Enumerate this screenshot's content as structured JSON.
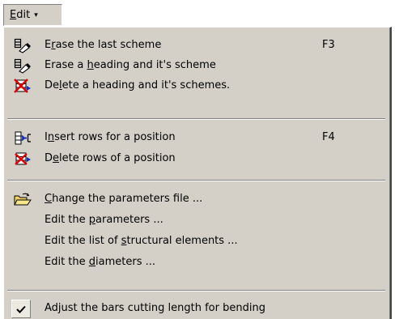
{
  "menu": {
    "title_underlined": "E",
    "title_rest": "dit",
    "arrow": "▾"
  },
  "items": [
    {
      "icon": "erase-scheme-icon",
      "before": "E",
      "u": "r",
      "after": "ase the last scheme",
      "shortcut": "F3"
    },
    {
      "icon": "erase-heading-icon",
      "before": "Erase a ",
      "u": "h",
      "after": "eading and it's scheme",
      "shortcut": ""
    },
    {
      "icon": "delete-heading-icon",
      "before": "De",
      "u": "l",
      "after": "ete a heading and it's schemes.",
      "shortcut": ""
    },
    {
      "icon": "insert-rows-icon",
      "before": "I",
      "u": "n",
      "after": "sert rows for a position",
      "shortcut": "F4"
    },
    {
      "icon": "delete-rows-icon",
      "before": "D",
      "u": "e",
      "after": "lete rows of a position",
      "shortcut": ""
    },
    {
      "icon": "open-folder-icon",
      "before": "",
      "u": "C",
      "after": "hange the parameters file ...",
      "shortcut": ""
    },
    {
      "icon": "",
      "before": "Edit the ",
      "u": "p",
      "after": "arameters ...",
      "shortcut": ""
    },
    {
      "icon": "",
      "before": "Edit the list of ",
      "u": "s",
      "after": "tructural elements ...",
      "shortcut": ""
    },
    {
      "icon": "",
      "before": "Edit the ",
      "u": "d",
      "after": "iameters ...",
      "shortcut": ""
    },
    {
      "icon": "check-icon",
      "before": "Adjust the bars cutting length for bending",
      "u": "",
      "after": "",
      "shortcut": ""
    }
  ],
  "colors": {
    "menu_bg": "#d4d0c8",
    "red_icon": "#e00000",
    "blue_icon": "#1030c0"
  }
}
